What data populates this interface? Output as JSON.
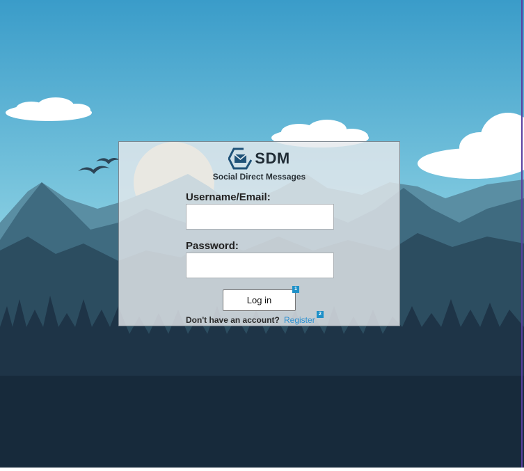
{
  "brand": {
    "name": "SDM",
    "tagline": "Social Direct Messages"
  },
  "login": {
    "username_label": "Username/Email:",
    "username_value": "",
    "password_label": "Password:",
    "password_value": "",
    "login_button": "Log in",
    "login_tag": "1",
    "no_account_text": "Don't have an account?",
    "register_link": "Register",
    "register_tag": "2"
  },
  "colors": {
    "sky_top": "#3a9cc9",
    "sky_bottom": "#bde9f0",
    "mountain_far": "#3f6b80",
    "mountain_near": "#2c4d60",
    "forest": "#1a2e40",
    "link": "#2a8fd0"
  },
  "icons": {
    "logo": "envelope-hexagon-icon",
    "birds": "birds-illustration",
    "sun": "sun-illustration"
  }
}
